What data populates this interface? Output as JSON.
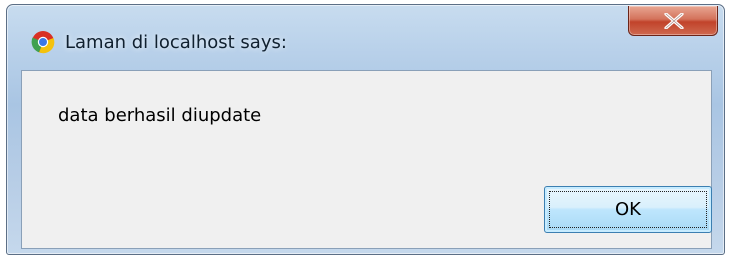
{
  "dialog": {
    "title": "Laman di localhost says:",
    "app_icon": "chrome-icon",
    "close_icon": "close-icon",
    "close_glyph": "X",
    "message": "data berhasil diupdate",
    "ok_label": "OK"
  }
}
